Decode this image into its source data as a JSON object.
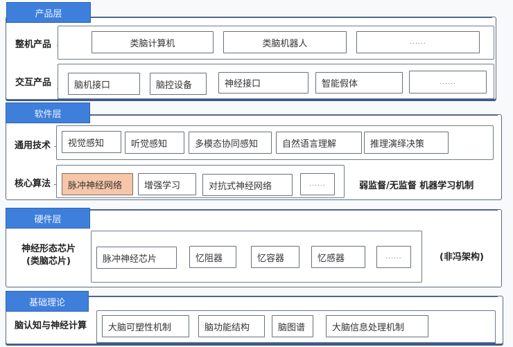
{
  "layers": [
    {
      "title": "产品层",
      "rows": [
        {
          "label": "整机产品",
          "items": [
            "类脑计算机",
            "类脑机器人",
            "......"
          ]
        },
        {
          "label": "交互产品",
          "items": [
            "脑机接口",
            "脑控设备",
            "神经接口",
            "智能假体",
            "......"
          ]
        }
      ]
    },
    {
      "title": "软件层",
      "rows": [
        {
          "label": "通用技术",
          "items": [
            "视觉感知",
            "听觉感知",
            "多模态协同感知",
            "自然语言理解",
            "推理演绎决策"
          ]
        },
        {
          "label": "核心算法",
          "items": [
            "脉冲神经网络",
            "增强学习",
            "对抗式神经网络",
            "......"
          ],
          "highlighted_item": "脉冲神经网络"
        }
      ],
      "note": "弱监督/无监督 机器学习机制"
    },
    {
      "title": "硬件层",
      "rows": [
        {
          "label_line1": "神经形态芯片",
          "label_line2": "(类脑芯片)",
          "items": [
            "脉冲神经芯片",
            "忆阻器",
            "忆容器",
            "忆感器",
            "......"
          ]
        }
      ],
      "note": "(非冯架构)"
    },
    {
      "title": "基础理论",
      "rows": [
        {
          "label": "脑认知与神经计算",
          "items": [
            "大脑可塑性机制",
            "脑功能结构",
            "脑图谱",
            "大脑信息处理机制"
          ]
        }
      ]
    }
  ],
  "colors": {
    "tab_blue": "#3f7fdc",
    "highlight": "#f7c6a8",
    "border": "#5a6a7e"
  }
}
